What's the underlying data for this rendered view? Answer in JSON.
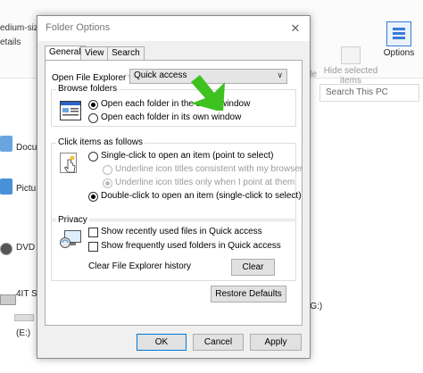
{
  "background": {
    "left_fragments": [
      "edium-siz",
      "etails"
    ],
    "hide_selected_label": "Hide selected items",
    "options_label": "Options",
    "search_placeholder": "Search This PC",
    "items": [
      {
        "label": "Docu"
      },
      {
        "label": "Pictu"
      },
      {
        "label": "DVD"
      },
      {
        "label": "4IT S"
      },
      {
        "label": "(E:)"
      }
    ],
    "right_drive_label": "(G:)",
    "fragment_chevron": "ns",
    "fragment_de": "de"
  },
  "dialog": {
    "title": "Folder Options",
    "close_glyph": "✕",
    "tabs": [
      {
        "label": "General",
        "active": true
      },
      {
        "label": "View",
        "active": false
      },
      {
        "label": "Search",
        "active": false
      }
    ],
    "open_to_label": "Open File Explorer to:",
    "open_to_value": "Quick access",
    "browse_folders": {
      "title": "Browse folders",
      "options": [
        {
          "label": "Open each folder in the same window",
          "checked": true
        },
        {
          "label": "Open each folder in its own window",
          "checked": false
        }
      ]
    },
    "click_items": {
      "title": "Click items as follows",
      "single_click": "Single-click to open an item (point to select)",
      "underline_browser": "Underline icon titles consistent with my browser",
      "underline_point": "Underline icon titles only when I point at them",
      "double_click": "Double-click to open an item (single-click to select)"
    },
    "privacy": {
      "title": "Privacy",
      "recent_files": "Show recently used files in Quick access",
      "frequent_folders": "Show frequently used folders in Quick access",
      "clear_history_label": "Clear File Explorer history",
      "clear_button": "Clear"
    },
    "restore_defaults": "Restore Defaults",
    "ok": "OK",
    "cancel": "Cancel",
    "apply": "Apply"
  },
  "colors": {
    "accent_cursor": "#3ec21f",
    "focus_border": "#0078d7"
  }
}
